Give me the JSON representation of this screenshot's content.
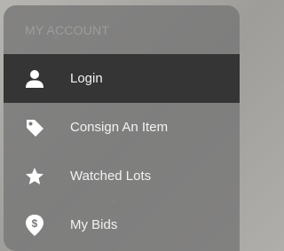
{
  "account_menu": {
    "header": "MY ACCOUNT",
    "items": [
      {
        "label": "Login",
        "icon": "person-icon",
        "active": true
      },
      {
        "label": "Consign An Item",
        "icon": "tag-icon",
        "active": false
      },
      {
        "label": "Watched Lots",
        "icon": "star-icon",
        "active": false
      },
      {
        "label": "My Bids",
        "icon": "dollar-pin-icon",
        "active": false
      }
    ]
  },
  "colors": {
    "panel_background": "#787878",
    "active_item_background": "#353535",
    "item_text": "#f2f2f2",
    "header_text": "#9c9c9c"
  }
}
